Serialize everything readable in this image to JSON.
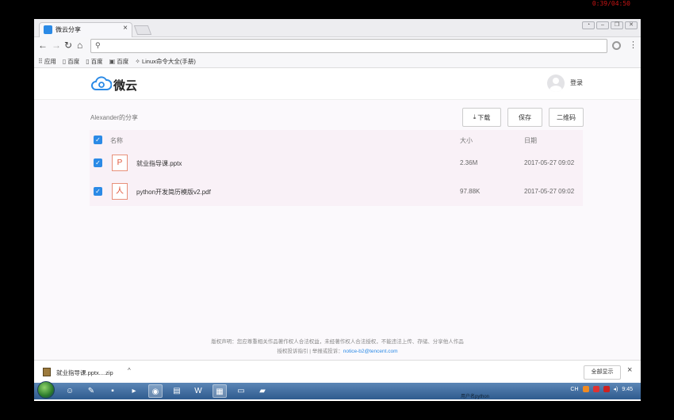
{
  "overlay": {
    "clock": "0:39/04:50"
  },
  "browser": {
    "tab_title": "微云分享",
    "tab_close": "×",
    "address": "",
    "bookmarks": [
      {
        "label": "应用",
        "icon": "apps-grid-icon"
      },
      {
        "label": "百度",
        "icon": "page-icon"
      },
      {
        "label": "百度",
        "icon": "page-icon"
      },
      {
        "label": "百度",
        "icon": "image-icon"
      },
      {
        "label": "Linux命令大全(手册)",
        "icon": "linux-icon"
      }
    ]
  },
  "header": {
    "logo_text": "微云",
    "login_label": "登录"
  },
  "share": {
    "owner_text": "Alexander的分享",
    "download_label": "下载",
    "save_label": "保存",
    "qrcode_label": "二维码"
  },
  "table": {
    "columns": {
      "name": "名称",
      "size": "大小",
      "date": "日期"
    },
    "files": [
      {
        "name": "就业指导课.pptx",
        "size": "2.36M",
        "date": "2017-05-27 09:02",
        "type": "pptx",
        "icon_glyph": "P"
      },
      {
        "name": "python开发简历模版v2.pdf",
        "size": "97.88K",
        "date": "2017-05-27 09:02",
        "type": "pdf",
        "icon_glyph": "人"
      }
    ]
  },
  "footer": {
    "line1": "版权声明：您应尊重相关作品著作权人合法权益，未经著作权人合法授权，不能违法上传、存储、分享他人作品",
    "line2_prefix": "授权投诉指引 | 举报或投诉：",
    "email": "notice-b2@tencent.com"
  },
  "downloads": {
    "file": "就业指导课.pptx....zip",
    "show_all": "全部显示",
    "close": "×"
  },
  "taskbar": {
    "time": "9:45",
    "lang": "CH",
    "user_text": "用户名python"
  },
  "colors": {
    "accent": "#2b8ae6",
    "file_icon": "#e0553a",
    "row_bg": "#f9f1f7"
  }
}
